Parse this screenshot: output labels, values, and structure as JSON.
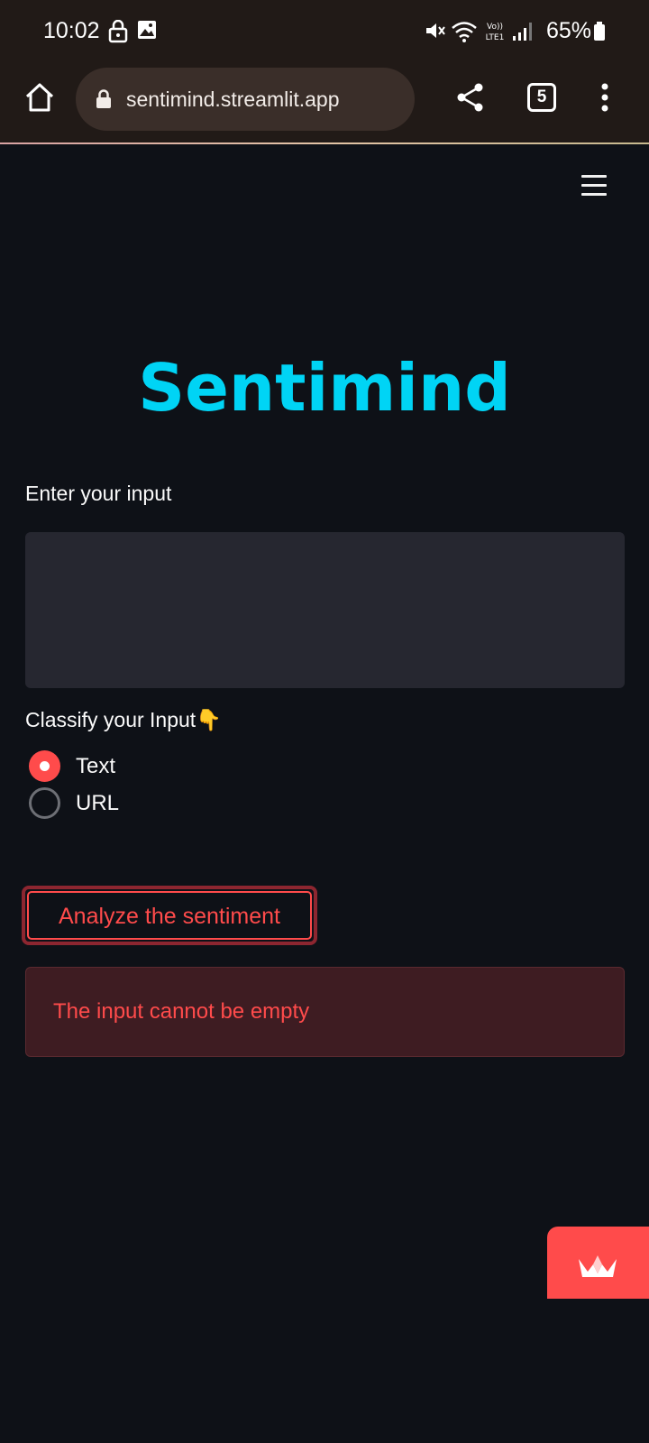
{
  "status_bar": {
    "time": "10:02",
    "battery": "65%",
    "icons": [
      "lock-icon",
      "image-icon",
      "mute-icon",
      "wifi-icon",
      "volte-lte-icon",
      "signal-icon",
      "battery-icon"
    ]
  },
  "browser": {
    "url": "sentimind.streamlit.app",
    "tab_count": "5"
  },
  "app": {
    "title": "Sentimind",
    "input_label": "Enter your input",
    "input_value": "",
    "classify_label": "Classify your Input👇",
    "radio_options": [
      {
        "label": "Text",
        "selected": true
      },
      {
        "label": "URL",
        "selected": false
      }
    ],
    "analyze_button": "Analyze the sentiment",
    "error_message": "The input cannot be empty"
  },
  "colors": {
    "background": "#0e1117",
    "title": "#00d4f5",
    "accent": "#ff4b4b",
    "input_bg": "#262730",
    "error_bg": "#3e1c22"
  }
}
